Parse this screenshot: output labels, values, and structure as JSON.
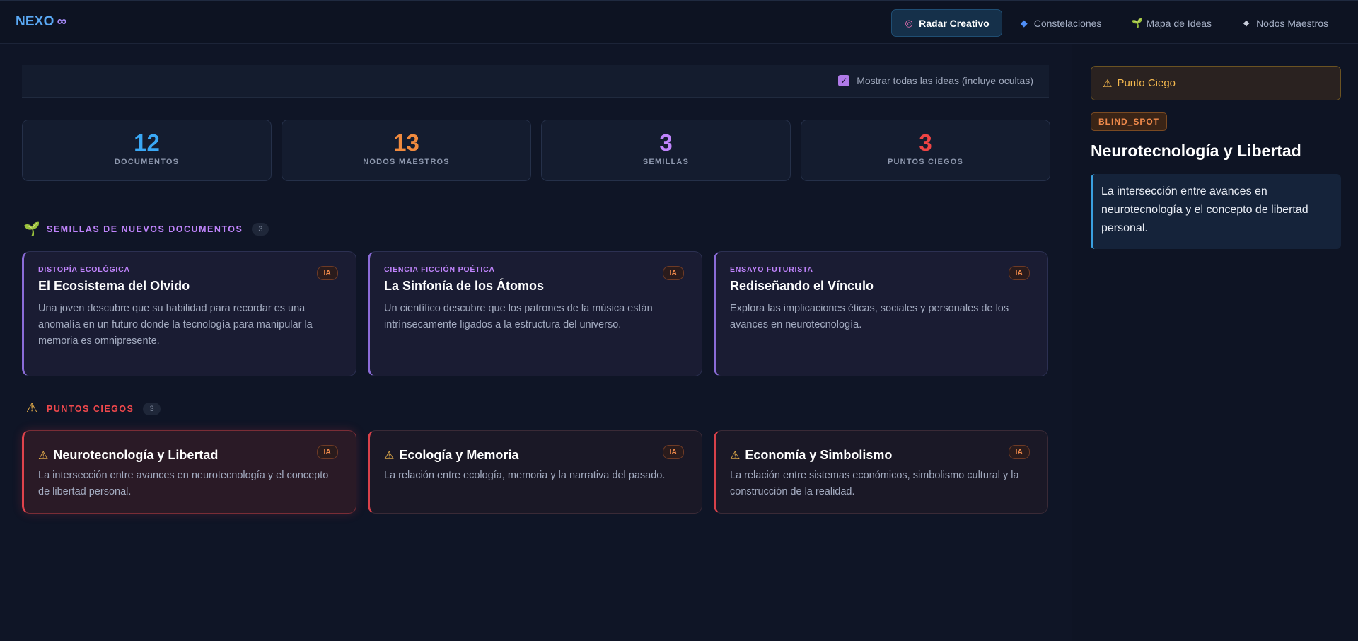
{
  "app": {
    "logo_text": "NEXO",
    "logo_symbol": "∞",
    "accent": "#5aa9f5"
  },
  "nav": [
    {
      "label": "Radar Creativo",
      "icon": "radar-icon",
      "glyph": "◎",
      "active": true
    },
    {
      "label": "Constelaciones",
      "icon": "diamond-icon",
      "glyph": "◆",
      "active": false
    },
    {
      "label": "Mapa de Ideas",
      "icon": "sprout-icon",
      "glyph": "🌱",
      "active": false
    },
    {
      "label": "Nodos Maestros",
      "icon": "node-icon",
      "glyph": "◆",
      "active": false
    }
  ],
  "filter": {
    "show_all_label": "Mostrar todas las ideas (incluye ocultas)",
    "checked": true
  },
  "stats": [
    {
      "value": "12",
      "label": "DOCUMENTOS",
      "color": "#3aa8f5"
    },
    {
      "value": "13",
      "label": "NODOS MAESTROS",
      "color": "#f08a3e"
    },
    {
      "value": "3",
      "label": "SEMILLAS",
      "color": "#c084fc"
    },
    {
      "value": "3",
      "label": "PUNTOS CIEGOS",
      "color": "#ef4444"
    }
  ],
  "seeds": {
    "icon": "sprout-icon",
    "title": "SEMILLAS DE NUEVOS DOCUMENTOS",
    "count": "3",
    "cards": [
      {
        "tag": "DISTOPÍA ECOLÓGICA",
        "title": "El Ecosistema del Olvido",
        "desc": "Una joven descubre que su habilidad para recordar es una anomalía en un futuro donde la tecnología para manipular la memoria es omnipresente.",
        "badge": "IA"
      },
      {
        "tag": "CIENCIA FICCIÓN POÉTICA",
        "title": "La Sinfonía de los Átomos",
        "desc": "Un científico descubre que los patrones de la música están intrínsecamente ligados a la estructura del universo.",
        "badge": "IA"
      },
      {
        "tag": "ENSAYO FUTURISTA",
        "title": "Rediseñando el Vínculo",
        "desc": "Explora las implicaciones éticas, sociales y personales de los avances en neurotecnología.",
        "badge": "IA"
      }
    ]
  },
  "blind_spots": {
    "icon": "warning-icon",
    "title": "PUNTOS CIEGOS",
    "count": "3",
    "cards": [
      {
        "title": "Neurotecnología y Libertad",
        "desc": "La intersección entre avances en neurotecnología y el concepto de libertad personal.",
        "badge": "IA",
        "selected": true
      },
      {
        "title": "Ecología y Memoria",
        "desc": "La relación entre ecología, memoria y la narrativa del pasado.",
        "badge": "IA",
        "selected": false
      },
      {
        "title": "Economía y Simbolismo",
        "desc": "La relación entre sistemas económicos, simbolismo cultural y la construcción de la realidad.",
        "badge": "IA",
        "selected": false
      }
    ]
  },
  "sidebar": {
    "alert_label": "Punto Ciego",
    "tag": "BLIND_SPOT",
    "title": "Neurotecnología y Libertad",
    "description": "La intersección entre avances en neurotecnología y el concepto de libertad personal."
  }
}
